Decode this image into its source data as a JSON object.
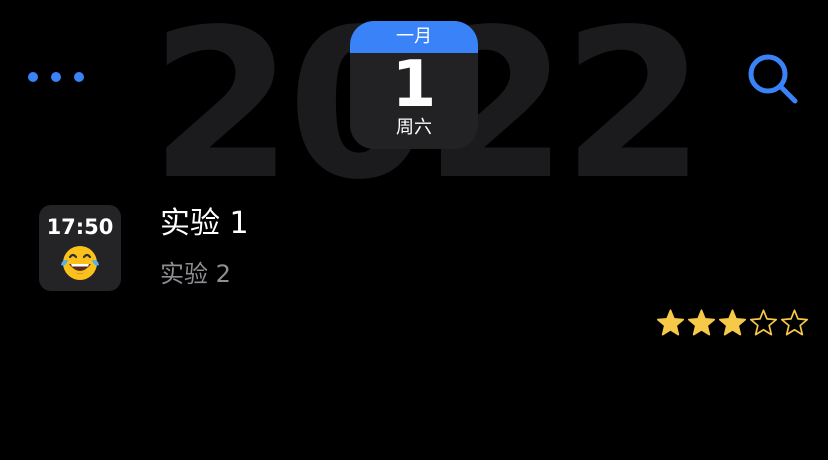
{
  "header": {
    "year": "2022",
    "more_icon": "ellipsis-icon",
    "search_icon": "search-icon",
    "accent_color": "#3a82f7"
  },
  "calendar": {
    "month": "一月",
    "day": "1",
    "weekday": "周六"
  },
  "entry": {
    "time": "17:50",
    "mood_icon": "tears-of-joy-emoji-icon",
    "title": "实验 1",
    "subtitle": "实验 2",
    "rating": {
      "value": 3,
      "max": 5,
      "star_color": "#f7c948"
    }
  }
}
